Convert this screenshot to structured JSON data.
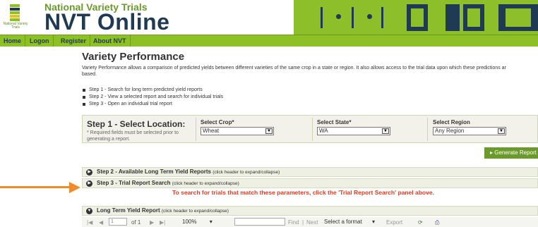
{
  "header": {
    "logo_text": "National Variety Trials",
    "subtitle": "National Variety Trials",
    "title": "NVT Online",
    "colors": {
      "green": "#8dc025",
      "navy": "#1f3a52"
    }
  },
  "nav": {
    "items": [
      "Home",
      "Logon",
      "Register",
      "About NVT"
    ]
  },
  "main": {
    "title": "Variety Performance",
    "intro_line1": "Variety Performance allows a comparison of predicted yields between different varieties of the same crop in a state or region. It also allows access to the trial data upon which these predictions ar",
    "intro_line2": "based.",
    "steps": [
      "Step 1 - Search for long term predicted yield reports",
      "Step 2 - View a selected report and search for individual trials",
      "Step 3 - Open an individual trial report"
    ]
  },
  "location": {
    "title": "Step 1 - Select Location:",
    "note": "* Required fields must be selected prior to generating a report.",
    "crop_label": "Select Crop*",
    "crop_value": "Wheat",
    "state_label": "Select State*",
    "state_value": "WA",
    "region_label": "Select Region",
    "region_value": "Any Region"
  },
  "generate_button": "Generate Report",
  "panels": {
    "step2_title": "Step 2 - Available Long Term Yield Reports",
    "step2_hint": "(click header to expand/collapse)",
    "step3_title": "Step 3 - Trial Report Search",
    "step3_hint": "(click header to expand/collapse)",
    "red_message": "To search for trials that match these parameters, click the 'Trial Report Search' panel above.",
    "ltyr_title": "Long Term Yield Report",
    "ltyr_hint": "(click header to expand/collapse)"
  },
  "toolbar": {
    "page_value": "1",
    "page_of": "of 1",
    "zoom": "100%",
    "find": "Find",
    "separator": "|",
    "next": "Next",
    "format": "Select a format",
    "export": "Export"
  }
}
